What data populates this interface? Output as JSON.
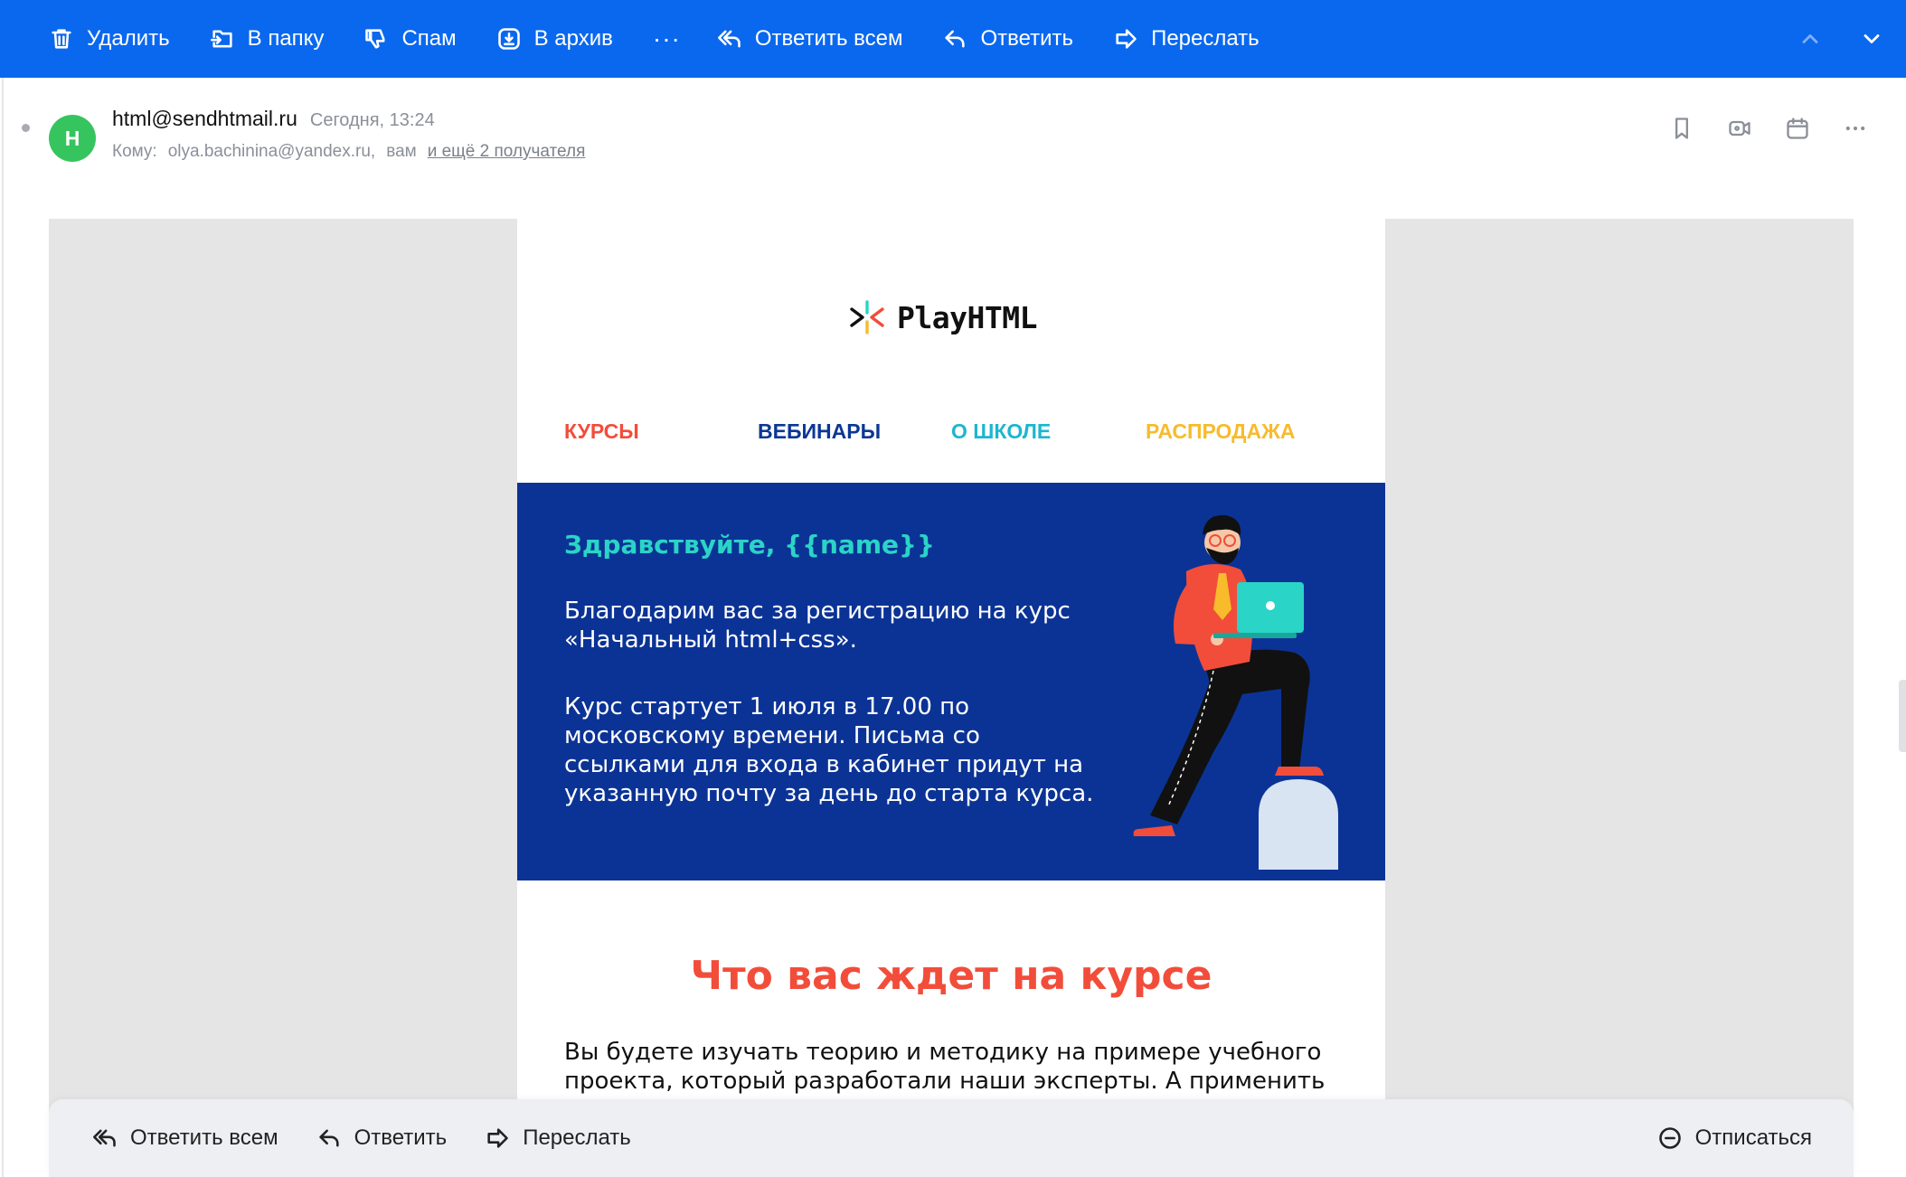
{
  "toolbar": {
    "delete": "Удалить",
    "to_folder": "В папку",
    "spam": "Спам",
    "archive": "В архив",
    "more": "···",
    "reply_all": "Ответить всем",
    "reply": "Ответить",
    "forward": "Переслать"
  },
  "message": {
    "avatar_letter": "H",
    "from": "html@sendhtmail.ru",
    "date": "Сегодня, 13:24",
    "to_label": "Кому:",
    "to_email": "olya.bachinina@yandex.ru,",
    "to_you": "вам",
    "to_more": "и ещё 2 получателя"
  },
  "email": {
    "logo_text": "PlayHTML",
    "nav": {
      "courses": "КУРСЫ",
      "webinars": "ВЕБИНАРЫ",
      "about": "О ШКОЛЕ",
      "sale": "РАСПРОДАЖА"
    },
    "greeting": "Здравствуйте, {{name}}",
    "paragraph1": "Благодарим вас за регистрацию на курс «Начальный html+css».",
    "paragraph2": "Курс стартует 1 июля в 17.00 по московскому времени. Письма со ссылками для входа в кабинет придут на указанную почту за день до старта курса.",
    "section_title": "Что вас ждет на курсе",
    "section_text": "Вы будете изучать теорию и методику на примере учебного проекта, который разработали наши эксперты. А применить"
  },
  "bottom_bar": {
    "reply_all": "Ответить всем",
    "reply": "Ответить",
    "forward": "Переслать",
    "unsubscribe": "Отписаться"
  },
  "colors": {
    "toolbar_blue": "#0a68ef",
    "hero_blue": "#0b3396",
    "accent_red": "#f24d3a",
    "accent_teal": "#2ad4c6",
    "avatar_green": "#36c45f"
  }
}
